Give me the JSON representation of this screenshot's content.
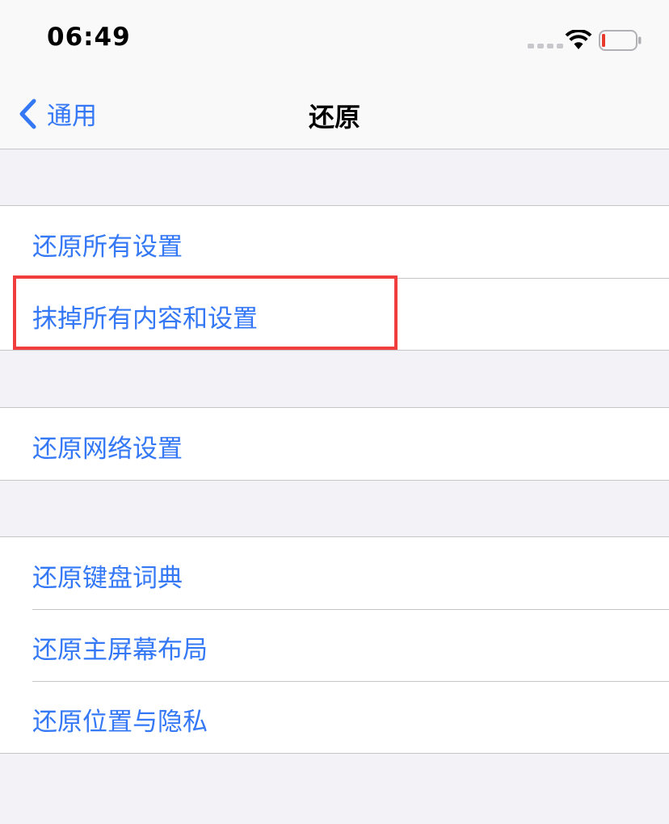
{
  "status_bar": {
    "time": "06:49"
  },
  "nav": {
    "back_label": "通用",
    "title": "还原"
  },
  "groups": [
    {
      "items": [
        {
          "label": "还原所有设置"
        },
        {
          "label": "抹掉所有内容和设置"
        }
      ]
    },
    {
      "items": [
        {
          "label": "还原网络设置"
        }
      ]
    },
    {
      "items": [
        {
          "label": "还原键盘词典"
        },
        {
          "label": "还原主屏幕布局"
        },
        {
          "label": "还原位置与隐私"
        }
      ]
    }
  ],
  "highlight": {
    "target": "抹掉所有内容和设置",
    "color": "#f03e3e"
  },
  "colors": {
    "accent": "#3478f6",
    "background": "#f2f2f7",
    "separator": "#c6c6c8"
  },
  "icons": {
    "back": "chevron-left-icon",
    "signal": "cellular-signal-icon",
    "wifi": "wifi-icon",
    "battery": "battery-low-icon"
  }
}
